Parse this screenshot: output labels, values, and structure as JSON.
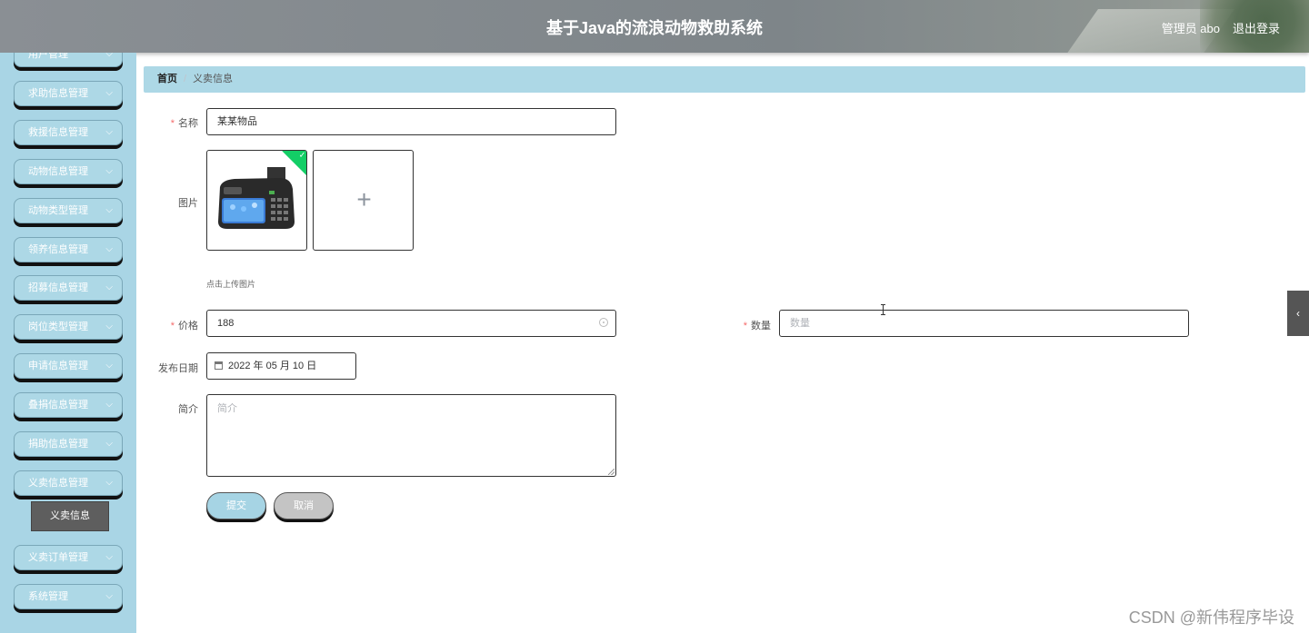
{
  "header": {
    "title": "基于Java的流浪动物救助系统",
    "user": "管理员 abo",
    "logout": "退出登录"
  },
  "sidebar": {
    "items": [
      {
        "label": "用户管理"
      },
      {
        "label": "求助信息管理"
      },
      {
        "label": "救援信息管理"
      },
      {
        "label": "动物信息管理"
      },
      {
        "label": "动物类型管理"
      },
      {
        "label": "领养信息管理"
      },
      {
        "label": "招募信息管理"
      },
      {
        "label": "岗位类型管理"
      },
      {
        "label": "申请信息管理"
      },
      {
        "label": "叠捐信息管理"
      },
      {
        "label": "捐助信息管理"
      },
      {
        "label": "义卖信息管理"
      },
      {
        "label": "义卖订单管理"
      },
      {
        "label": "系统管理"
      }
    ],
    "submenu_active": "义卖信息",
    "accent_color": "#add8e6"
  },
  "breadcrumb": {
    "home": "首页",
    "current": "义卖信息"
  },
  "form": {
    "name": {
      "label": "名称",
      "value": "某某物品"
    },
    "image": {
      "label": "图片",
      "hint": "点击上传图片"
    },
    "price": {
      "label": "价格",
      "value": "188"
    },
    "quantity": {
      "label": "数量",
      "placeholder": "数量"
    },
    "publish_date": {
      "label": "发布日期",
      "value": "2022 年 05 月 10 日"
    },
    "intro": {
      "label": "简介",
      "placeholder": "简介"
    },
    "submit": "提交",
    "cancel": "取消"
  },
  "watermark": "CSDN @新伟程序毕设"
}
